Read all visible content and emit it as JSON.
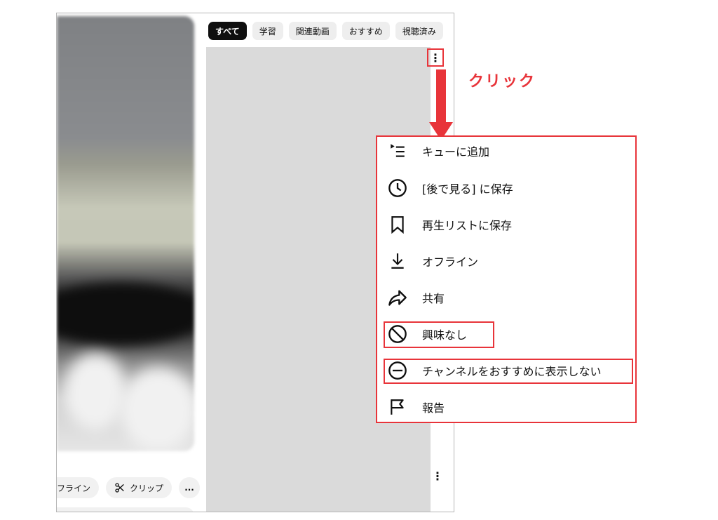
{
  "annotation": {
    "click_label": "クリック",
    "accent_color": "#e8343a"
  },
  "filter_chips": [
    {
      "label": "すべて",
      "active": true
    },
    {
      "label": "学習",
      "active": false
    },
    {
      "label": "関連動画",
      "active": false
    },
    {
      "label": "おすすめ",
      "active": false
    },
    {
      "label": "視聴済み",
      "active": false
    }
  ],
  "player_actions": {
    "offline_label_partial": "フライン",
    "clip_label": "クリップ",
    "more_label": "..."
  },
  "more_button": {
    "glyph": "⋮"
  },
  "context_menu": {
    "items": [
      {
        "label": "キューに追加",
        "icon": "add-to-queue-icon",
        "highlighted": false
      },
      {
        "label": "[後で見る] に保存",
        "icon": "clock-icon",
        "highlighted": false
      },
      {
        "label": "再生リストに保存",
        "icon": "bookmark-icon",
        "highlighted": false
      },
      {
        "label": "オフライン",
        "icon": "download-icon",
        "highlighted": false
      },
      {
        "label": "共有",
        "icon": "share-icon",
        "highlighted": false
      },
      {
        "label": "興味なし",
        "icon": "block-icon",
        "highlighted": true
      },
      {
        "label": "チャンネルをおすすめに表示しない",
        "icon": "minus-circle-icon",
        "highlighted": true
      },
      {
        "label": "報告",
        "icon": "flag-icon",
        "highlighted": false
      }
    ]
  }
}
